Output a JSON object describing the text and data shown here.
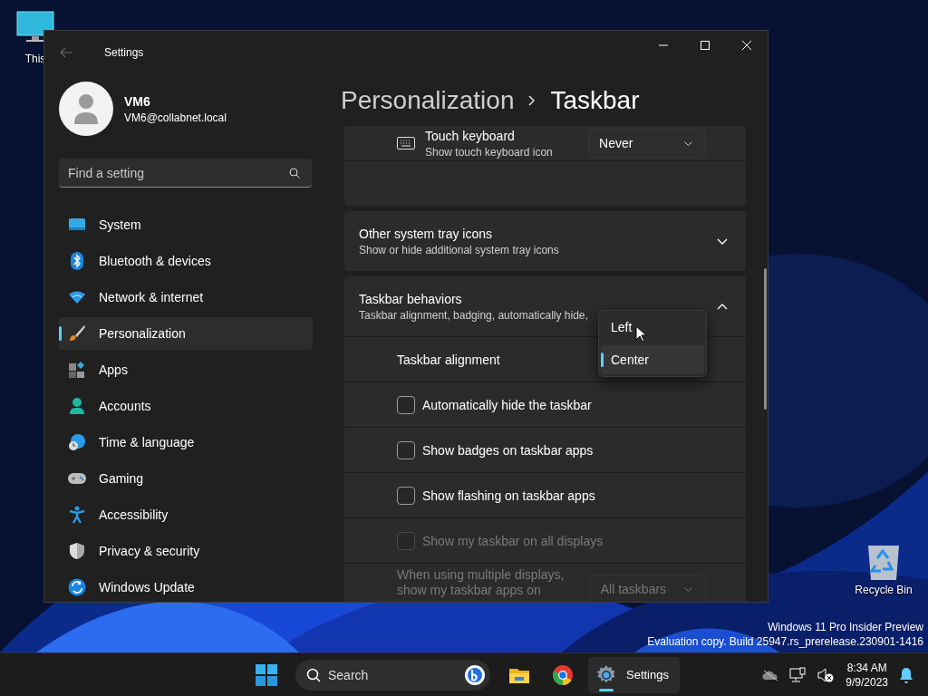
{
  "desktop": {
    "icons": [
      {
        "kind": "monitor",
        "label": "This"
      },
      {
        "kind": "recycle-bin",
        "label": "Recycle Bin"
      }
    ],
    "edition_notice": [
      "Windows 11 Pro Insider Preview",
      "Evaluation copy. Build 25947.rs_prerelease.230901-1416"
    ]
  },
  "window": {
    "title": "Settings"
  },
  "account": {
    "name": "VM6",
    "email": "VM6@collabnet.local"
  },
  "search": {
    "placeholder": "Find a setting"
  },
  "nav": [
    {
      "kind": "system",
      "label": "System",
      "selected": false
    },
    {
      "kind": "bluetooth",
      "label": "Bluetooth & devices",
      "selected": false
    },
    {
      "kind": "network",
      "label": "Network & internet",
      "selected": false
    },
    {
      "kind": "personalization",
      "label": "Personalization",
      "selected": true
    },
    {
      "kind": "apps",
      "label": "Apps",
      "selected": false
    },
    {
      "kind": "accounts",
      "label": "Accounts",
      "selected": false
    },
    {
      "kind": "time",
      "label": "Time & language",
      "selected": false
    },
    {
      "kind": "gaming",
      "label": "Gaming",
      "selected": false
    },
    {
      "kind": "accessibility",
      "label": "Accessibility",
      "selected": false
    },
    {
      "kind": "privacy",
      "label": "Privacy & security",
      "selected": false
    },
    {
      "kind": "update",
      "label": "Windows Update",
      "selected": false
    }
  ],
  "breadcrumb": [
    "Personalization",
    "Taskbar"
  ],
  "cards": [
    {
      "kind": "setting",
      "title": "Touch keyboard",
      "subtitle": "Show touch keyboard icon",
      "dropdown": "Never"
    },
    {
      "kind": "expander",
      "title": "Other system tray icons",
      "subtitle": "Show or hide additional system tray icons",
      "expanded": false
    },
    {
      "kind": "expander",
      "title": "Taskbar behaviors",
      "subtitle": "Taskbar alignment, badging, automatically hide,",
      "expanded": true,
      "rows": [
        {
          "kind": "dropdown",
          "label": "Taskbar alignment",
          "options": [
            {
              "label": "Left",
              "selected": false
            },
            {
              "label": "Center",
              "selected": true
            }
          ]
        },
        {
          "kind": "checkbox",
          "label": "Automatically hide the taskbar",
          "checked": false,
          "disabled": false
        },
        {
          "kind": "checkbox",
          "label": "Show badges on taskbar apps",
          "checked": false,
          "disabled": false
        },
        {
          "kind": "checkbox",
          "label": "Show flashing on taskbar apps",
          "checked": false,
          "disabled": false
        },
        {
          "kind": "checkbox",
          "label": "Show my taskbar on all displays",
          "checked": false,
          "disabled": true
        },
        {
          "kind": "select",
          "label": "When using multiple displays, show my taskbar apps on",
          "value": "All taskbars",
          "disabled": true
        }
      ]
    }
  ],
  "taskbar": {
    "search": {
      "placeholder": "Search"
    },
    "apps": [
      {
        "kind": "explorer",
        "selected": false
      },
      {
        "kind": "chrome",
        "selected": false
      },
      {
        "kind": "settings",
        "label": "Settings",
        "selected": true
      }
    ],
    "clock": {
      "time": "8:34 AM",
      "date": "9/9/2023"
    }
  }
}
